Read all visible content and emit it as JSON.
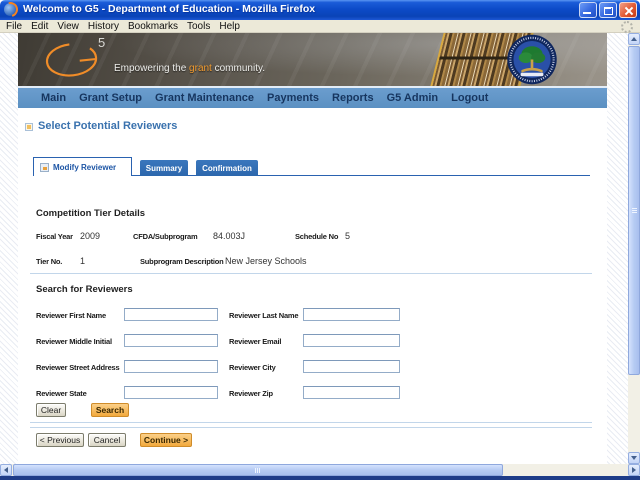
{
  "window": {
    "title": "Welcome to G5 - Department of Education - Mozilla Firefox"
  },
  "menu_bar": {
    "items": [
      "File",
      "Edit",
      "View",
      "History",
      "Bookmarks",
      "Tools",
      "Help"
    ]
  },
  "banner": {
    "logo_number": "5",
    "tagline_pre": "Empowering the ",
    "tagline_highlight": "grant",
    "tagline_post": " community."
  },
  "nav": {
    "items": [
      "Main",
      "Grant Setup",
      "Grant Maintenance",
      "Payments",
      "Reports",
      "G5 Admin",
      "Logout"
    ]
  },
  "page": {
    "heading": "Select Potential Reviewers"
  },
  "tabs": {
    "modify": "Modify Reviewer",
    "summary": "Summary",
    "confirmation": "Confirmation"
  },
  "tier_details": {
    "heading": "Competition Tier Details",
    "fiscal_year_label": "Fiscal Year",
    "fiscal_year_value": "2009",
    "cfda_label": "CFDA/Subprogram",
    "cfda_value": "84.003J",
    "schedule_label": "Schedule No",
    "schedule_value": "5",
    "tier_no_label": "Tier No.",
    "tier_no_value": "1",
    "subprogram_desc_label": "Subprogram Description",
    "subprogram_desc_value": "New Jersey Schools"
  },
  "search": {
    "heading": "Search for Reviewers",
    "fields": [
      {
        "label": "Reviewer First Name",
        "value": ""
      },
      {
        "label": "Reviewer Last Name",
        "value": ""
      },
      {
        "label": "Reviewer Middle Initial",
        "value": ""
      },
      {
        "label": "Reviewer Email",
        "value": ""
      },
      {
        "label": "Reviewer Street Address",
        "value": ""
      },
      {
        "label": "Reviewer City",
        "value": ""
      },
      {
        "label": "Reviewer State",
        "value": ""
      },
      {
        "label": "Reviewer Zip",
        "value": ""
      }
    ],
    "clear_label": "Clear",
    "search_label": "Search"
  },
  "footer_actions": {
    "previous_label": "< Previous",
    "cancel_label": "Cancel",
    "continue_label": "Continue >"
  },
  "colors": {
    "accent_orange": "#f0a83c",
    "nav_blue": "#5e93c6",
    "tab_blue": "#2f6cb3",
    "heading_blue": "#3a72ae",
    "divider_blue": "#c2d6ea",
    "titlebar_blue": "#0c4bc8",
    "bottom_strip_navy": "#1e3c88"
  }
}
